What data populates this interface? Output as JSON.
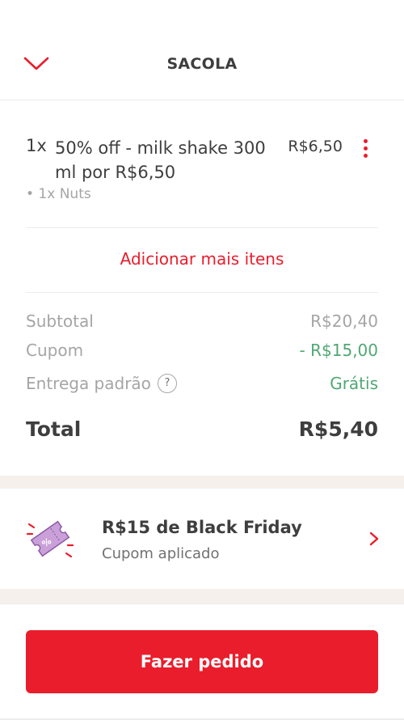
{
  "header": {
    "title": "SACOLA",
    "back_icon": "chevron-down-icon",
    "accent_color": "#ea1d2c"
  },
  "cart": {
    "items": [
      {
        "quantity": "1x",
        "name": "50% off - milk shake 300 ml por R$6,50",
        "price": "R$6,50",
        "addon": "• 1x Nuts",
        "menu_icon": "more-vertical-icon"
      }
    ],
    "add_more_label": "Adicionar mais itens"
  },
  "summary": {
    "subtotal_label": "Subtotal",
    "subtotal_value": "R$20,40",
    "coupon_label": "Cupom",
    "coupon_value": "- R$15,00",
    "delivery_label": "Entrega padrão",
    "delivery_help": "?",
    "delivery_value": "Grátis",
    "total_label": "Total",
    "total_value": "R$5,40",
    "discount_color": "#50a773"
  },
  "coupon_banner": {
    "icon": "coupon-ticket-icon",
    "title": "R$15 de Black Friday",
    "subtitle": "Cupom aplicado",
    "arrow_icon": "chevron-right-icon"
  },
  "footer": {
    "order_button_label": "Fazer pedido",
    "button_color": "#ea1d2c"
  }
}
